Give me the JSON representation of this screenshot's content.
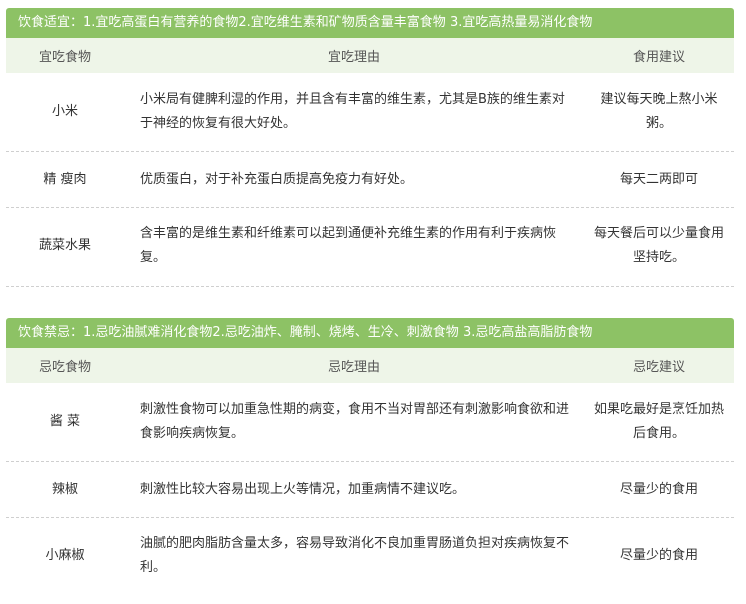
{
  "sections": [
    {
      "banner": "饮食适宜：1.宜吃高蛋白有营养的食物2.宜吃维生素和矿物质含量丰富食物 3.宜吃高热量易消化食物",
      "headers": [
        "宜吃食物",
        "宜吃理由",
        "食用建议"
      ],
      "rows": [
        {
          "food": "小米",
          "reason": "小米局有健脾利湿的作用，并且含有丰富的维生素，尤其是B族的维生素对于神经的恢复有很大好处。",
          "advice": "建议每天晚上熬小米粥。"
        },
        {
          "food": "精 瘦肉",
          "reason": "优质蛋白，对于补充蛋白质提高免疫力有好处。",
          "advice": "每天二两即可"
        },
        {
          "food": "蔬菜水果",
          "reason": "含丰富的是维生素和纤维素可以起到通便补充维生素的作用有利于疾病恢复。",
          "advice": "每天餐后可以少量食用坚持吃。"
        }
      ]
    },
    {
      "banner": "饮食禁忌：1.忌吃油腻难消化食物2.忌吃油炸、腌制、烧烤、生冷、刺激食物 3.忌吃高盐高脂肪食物",
      "headers": [
        "忌吃食物",
        "忌吃理由",
        "忌吃建议"
      ],
      "rows": [
        {
          "food": "酱 菜",
          "reason": "刺激性食物可以加重急性期的病变，食用不当对胃部还有刺激影响食欲和进食影响疾病恢复。",
          "advice": "如果吃最好是烹饪加热后食用。"
        },
        {
          "food": "辣椒",
          "reason": "刺激性比较大容易出现上火等情况，加重病情不建议吃。",
          "advice": "尽量少的食用"
        },
        {
          "food": "小麻椒",
          "reason": "油腻的肥肉脂肪含量太多，容易导致消化不良加重胃肠道负担对疾病恢复不利。",
          "advice": "尽量少的食用"
        }
      ]
    }
  ],
  "colors": {
    "banner": "#8dc265",
    "header_bg": "#eef5e8"
  }
}
